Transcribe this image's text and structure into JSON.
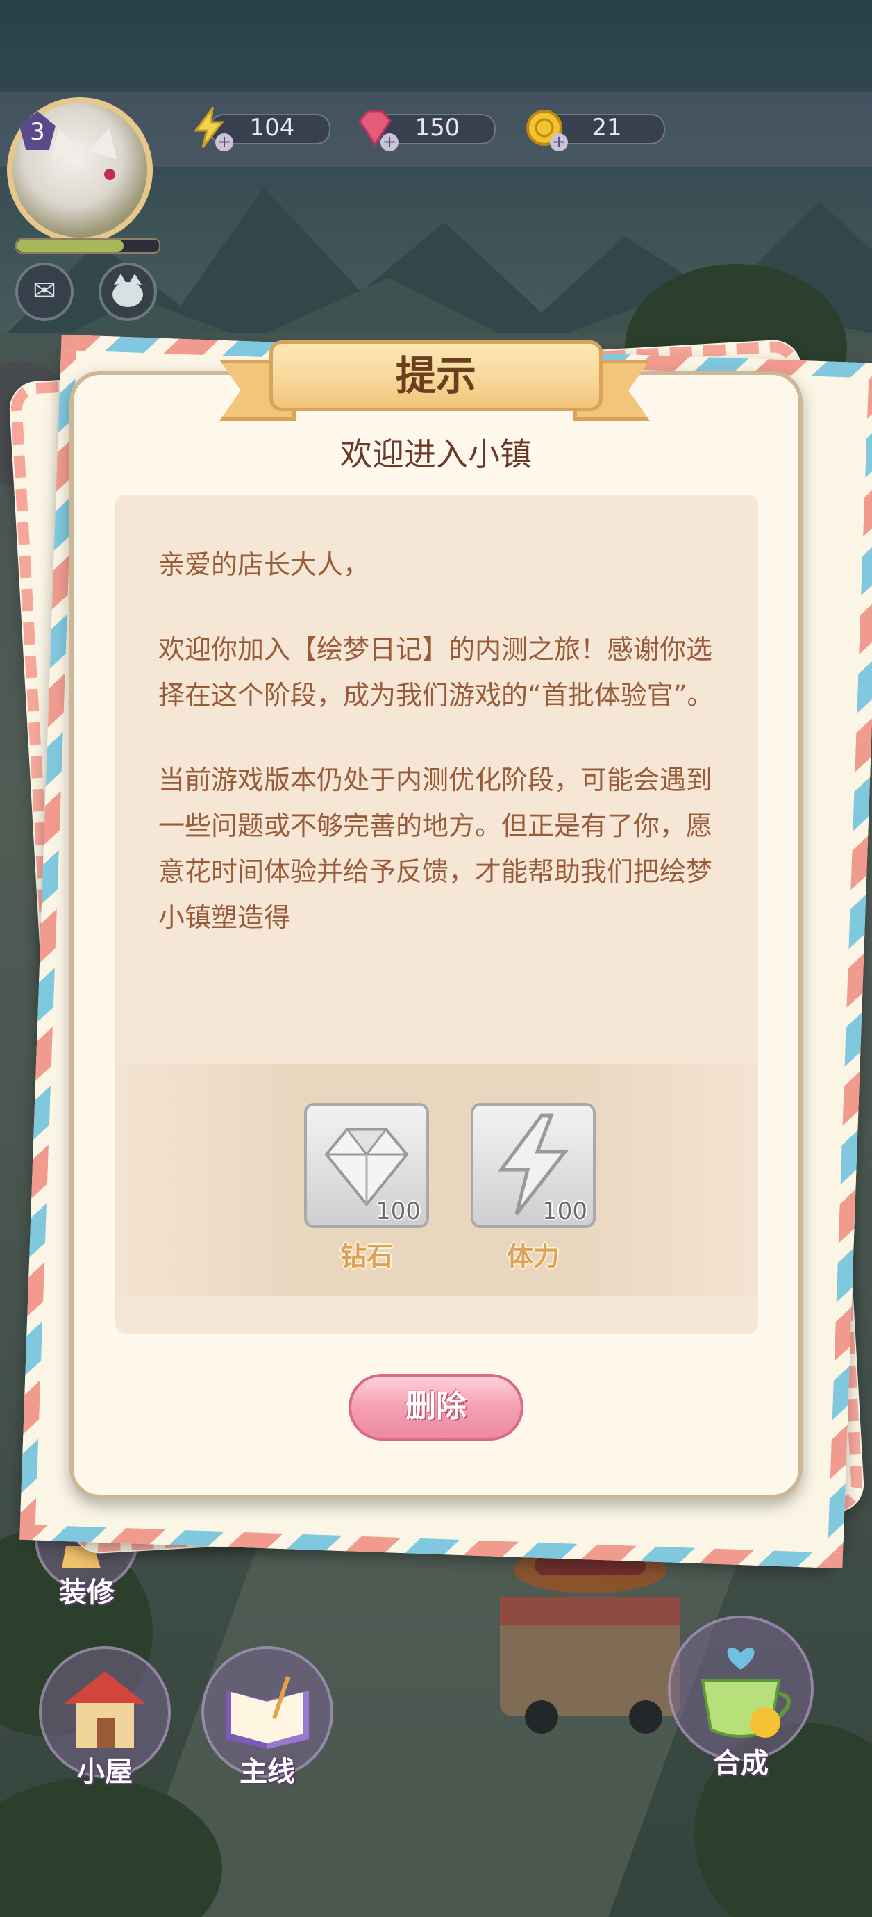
{
  "hud": {
    "level": "3",
    "xp_progress": 0.75,
    "energy": "104",
    "gems": "150",
    "coins": "21",
    "icons": [
      "lightning-icon",
      "gem-icon",
      "coin-icon",
      "mail-icon",
      "cat-face-icon"
    ]
  },
  "dialog": {
    "title": "提示",
    "subtitle": "欢迎进入小镇",
    "paragraphs": [
      "亲爱的店长大人，",
      "欢迎你加入【绘梦日记】的内测之旅！感谢你选择在这个阶段，成为我们游戏的“首批体验官”。",
      "当前游戏版本仍处于内测优化阶段，可能会遇到一些问题或不够完善的地方。但正是有了你，愿意花时间体验并给予反馈，才能帮助我们把绘梦小镇塑造得"
    ],
    "rewards": [
      {
        "name": "钻石",
        "amount": "100",
        "icon": "diamond-icon"
      },
      {
        "name": "体力",
        "amount": "100",
        "icon": "lightning-icon"
      }
    ],
    "delete_label": "删除"
  },
  "bottom_menu": {
    "decorate": "装修",
    "cabin": "小屋",
    "main_quest": "主线",
    "merge": "合成"
  },
  "colors": {
    "ribbon": "#f2c57a",
    "card": "#fef9ec",
    "text_brown": "#9a5b38",
    "delete_button": "#ec8aa1"
  }
}
